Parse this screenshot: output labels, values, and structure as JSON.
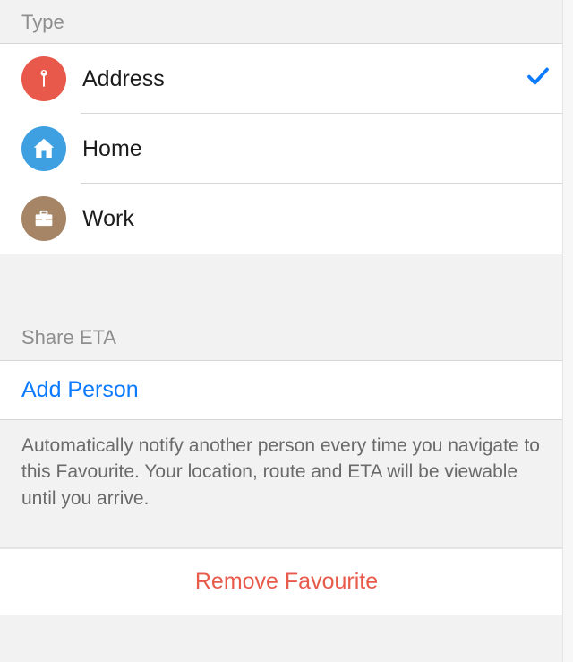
{
  "type_section": {
    "header": "Type",
    "options": [
      {
        "id": "address",
        "label": "Address",
        "icon": "pin-icon",
        "color": "#e8594b",
        "selected": true
      },
      {
        "id": "home",
        "label": "Home",
        "icon": "home-icon",
        "color": "#3ea0e0",
        "selected": false
      },
      {
        "id": "work",
        "label": "Work",
        "icon": "briefcase-icon",
        "color": "#a58565",
        "selected": false
      }
    ]
  },
  "share_section": {
    "header": "Share ETA",
    "add_label": "Add Person",
    "description": "Automatically notify another person every time you navigate to this Favourite. Your location, route and ETA will be viewable until you arrive."
  },
  "remove_section": {
    "label": "Remove Favourite"
  },
  "colors": {
    "accent": "#0a7aff",
    "destructive": "#e85b4b"
  }
}
